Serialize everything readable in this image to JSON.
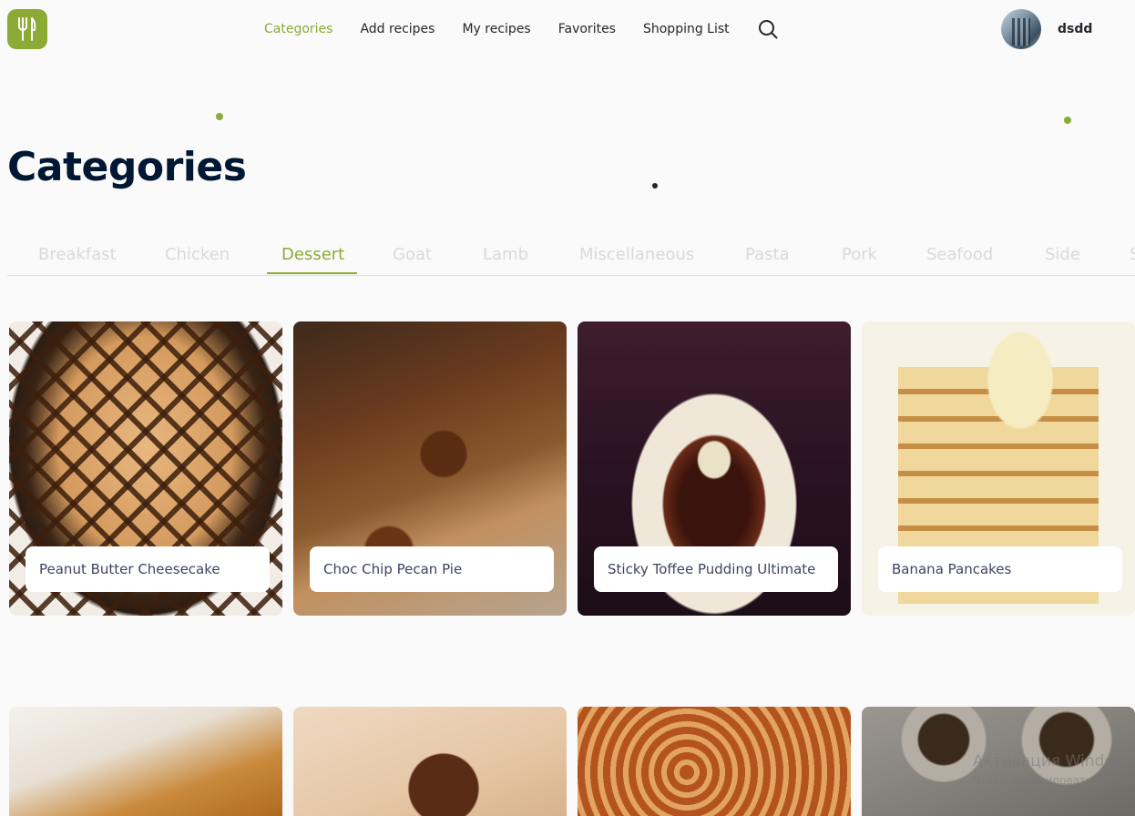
{
  "header": {
    "nav": [
      "Categories",
      "Add recipes",
      "My recipes",
      "Favorites",
      "Shopping List"
    ],
    "active_nav": "Categories",
    "username": "dsdd"
  },
  "page": {
    "title": "Categories"
  },
  "tabs": [
    "Breakfast",
    "Chicken",
    "Dessert",
    "Goat",
    "Lamb",
    "Miscellaneous",
    "Pasta",
    "Pork",
    "Seafood",
    "Side",
    "S"
  ],
  "active_tab": "Dessert",
  "recipes": [
    {
      "title": "Peanut Butter Cheesecake"
    },
    {
      "title": "Choc Chip Pecan Pie"
    },
    {
      "title": "Sticky Toffee Pudding Ultimate"
    },
    {
      "title": "Banana Pancakes"
    }
  ],
  "watermark": {
    "line1": "Активация Windows",
    "line2": "Чтобы активировать Windows"
  },
  "colors": {
    "accent": "#8baa36",
    "title": "#001833",
    "text": "#23262a"
  }
}
